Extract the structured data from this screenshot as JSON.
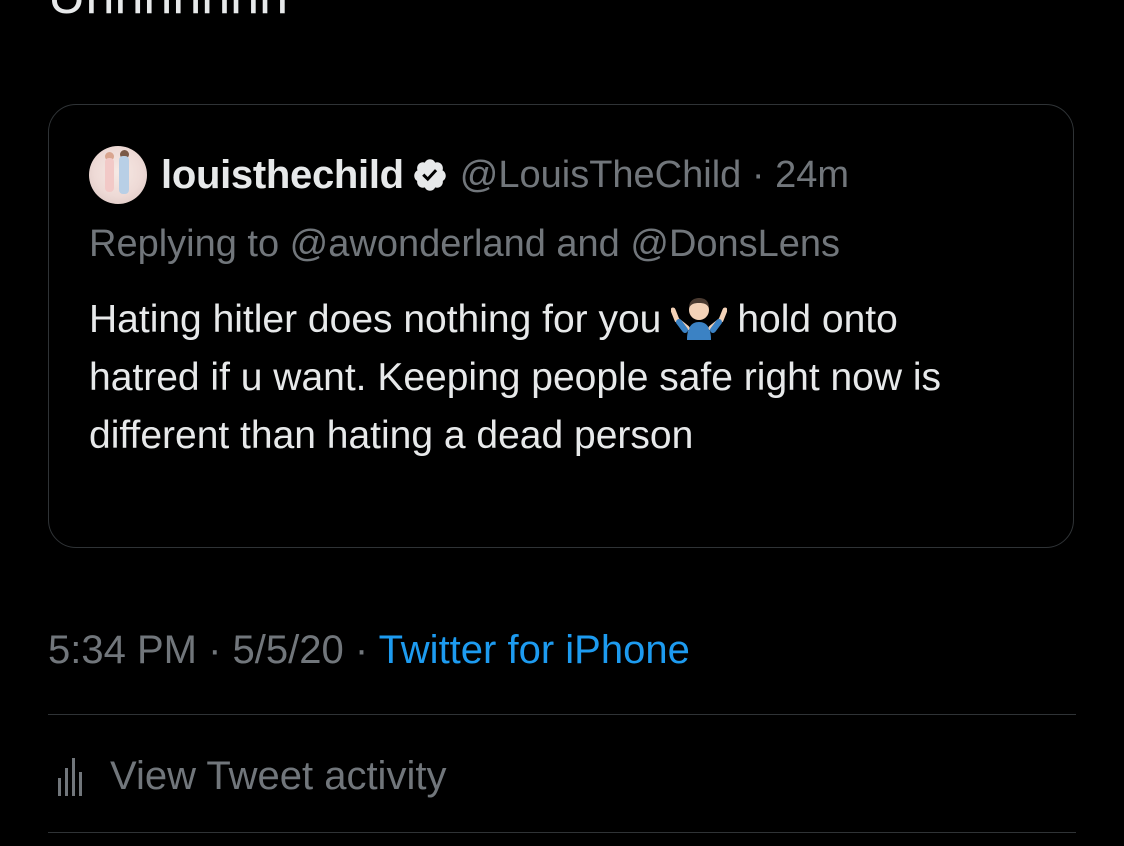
{
  "tweet": {
    "text_fragment": "Uhhhhhhh"
  },
  "quoted_tweet": {
    "display_name": "louisthechild",
    "handle": "@LouisTheChild",
    "separator": " · ",
    "time": "24m",
    "replying_to": "Replying to @awonderland and @DonsLens",
    "body_part1": "Hating hitler does nothing for you",
    "body_part2": "hold onto hatred if u want. Keeping people safe right now is different than hating a dead person",
    "verified_icon": "verified-badge-icon",
    "emoji_icon": "person-shrugging-emoji"
  },
  "meta": {
    "time": "5:34 PM",
    "separator1": " · ",
    "date": "5/5/20",
    "separator2": " · ",
    "source": "Twitter for iPhone"
  },
  "activity": {
    "label": "View Tweet activity",
    "icon": "analytics-bars-icon"
  },
  "colors": {
    "background": "#000000",
    "primary_text": "#e7e9ea",
    "secondary_text": "#71767b",
    "accent": "#1d9bf0",
    "border": "#2f3336"
  }
}
